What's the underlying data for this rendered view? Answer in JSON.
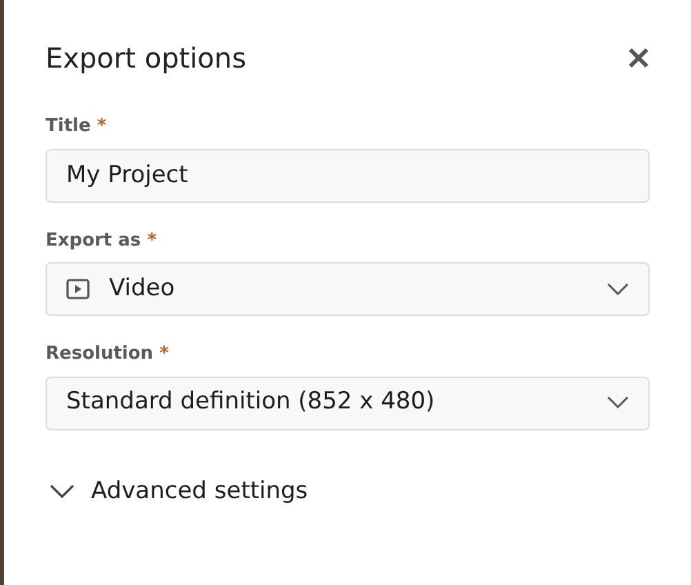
{
  "dialog": {
    "title": "Export options"
  },
  "fields": [
    {
      "kind": "text",
      "label": "Title",
      "required_mark": "*",
      "value": "My Project"
    },
    {
      "kind": "select-with-icon",
      "label": "Export as",
      "required_mark": "*",
      "value": "Video"
    },
    {
      "kind": "select",
      "label": "Resolution",
      "required_mark": "*",
      "value": "Standard definition (852 x 480)"
    }
  ],
  "advanced": {
    "label": "Advanced settings",
    "expanded": false
  }
}
